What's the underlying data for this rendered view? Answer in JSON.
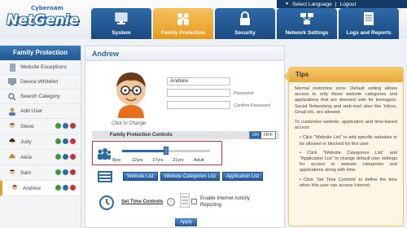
{
  "header": {
    "logo_small": "Cyberoam",
    "logo_main": "NetGenie",
    "select_language": "Select Language",
    "logout": "Logout",
    "tabs": [
      {
        "label": "System",
        "icon": "monitor-icon"
      },
      {
        "label": "Family Protection",
        "icon": "family-icon"
      },
      {
        "label": "Security",
        "icon": "lock-icon"
      },
      {
        "label": "Network Settings",
        "icon": "network-icon"
      },
      {
        "label": "Logs and Reports",
        "icon": "logs-icon"
      }
    ]
  },
  "sidebar": {
    "title": "Family Protection",
    "items": [
      {
        "label": "Website Exceptions",
        "icon": "document-icon"
      },
      {
        "label": "Device Whitelist",
        "icon": "device-icon"
      },
      {
        "label": "Search Category",
        "icon": "search-icon"
      },
      {
        "label": "Add User",
        "icon": "add-user-icon"
      }
    ],
    "users": [
      "Steve",
      "Judy",
      "Alice",
      "Sam",
      "Andrew"
    ],
    "active_user": "Andrew"
  },
  "main": {
    "title": "Andrew",
    "click_to_change": "Click to Change",
    "name_value": "Andrew",
    "password_label": "Password",
    "confirm_password_label": "Confirm Password",
    "fpc_label": "Family Protection Controls",
    "toggle_on": "ON",
    "toggle_off": "OFF",
    "age_labels": [
      "8yrs",
      "12yrs",
      "17yrs",
      "21yrs",
      "Adult"
    ],
    "age_level": 0.5,
    "website_list": "Website List",
    "website_categories_list": "Website Categories List",
    "application_list": "Application List",
    "set_time_controls": "Set Time Controls",
    "enable_report": "Enable Internet Activity Reporting",
    "apply": "Apply"
  },
  "tips": {
    "title": "Tips",
    "intro": "Normal restriction zone. Default setting allows access to only those website categories and applications that are deemed safe for teenagers. Social Networking and web-mail sites like Yahoo, Gmail etc. are allowed.",
    "customize": "To customize website, application and time-based access:",
    "bullets": [
      "• Click \"Website List\" to add specific websites to be allowed or blocked for this user.",
      "• Click \"Website Categories List\" and \"Application List\" to change default user settings for access to website categories and applications along with time.",
      "• Click 'Set Time Controls' to define the time when this user can access Internet."
    ]
  },
  "colors": {
    "accent": "#2b6aa8",
    "active_tab": "#f0a830",
    "highlight": "#e03030"
  }
}
